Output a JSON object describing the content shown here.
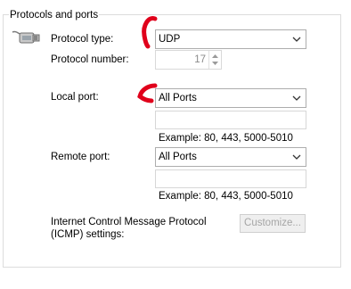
{
  "group": {
    "title": "Protocols and ports"
  },
  "protocol_type": {
    "label": "Protocol type:",
    "value": "UDP"
  },
  "protocol_number": {
    "label": "Protocol number:",
    "value": "17"
  },
  "local_port": {
    "label": "Local port:",
    "value": "All Ports",
    "input_value": "",
    "example": "Example: 80, 443, 5000-5010"
  },
  "remote_port": {
    "label": "Remote port:",
    "value": "All Ports",
    "input_value": "",
    "example": "Example: 80, 443, 5000-5010"
  },
  "icmp": {
    "label_line1": "Internet Control Message Protocol",
    "label_line2": "(ICMP) settings:",
    "button": "Customize..."
  },
  "colors": {
    "annotation": "#e0001b",
    "disabled_text": "#a5a5a5"
  },
  "icons": {
    "network": "network-cable-icon",
    "dropdown": "chevron-down-icon",
    "spin": "spin-arrows-icon"
  }
}
